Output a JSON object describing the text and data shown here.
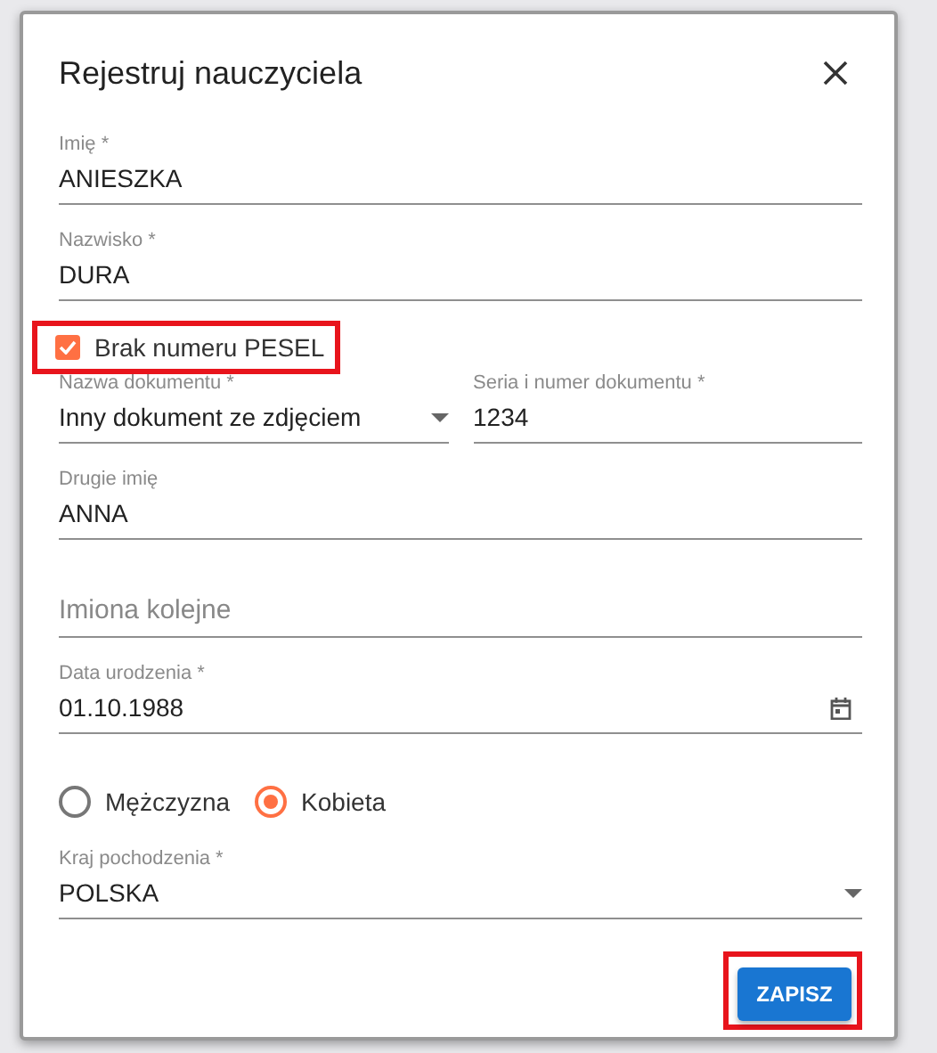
{
  "dialog": {
    "title": "Rejestruj nauczyciela"
  },
  "form": [
    {
      "kind": "text",
      "label": "Imię *",
      "value": "ANIESZKA"
    },
    {
      "kind": "text",
      "label": "Nazwisko *",
      "value": "DURA"
    },
    {
      "kind": "checkbox",
      "label": "Brak numeru PESEL",
      "checked": true,
      "highlighted": true
    },
    {
      "kind": "row",
      "items": [
        {
          "kind": "select",
          "label": "Nazwa dokumentu *",
          "value": "Inny dokument ze zdjęciem"
        },
        {
          "kind": "text",
          "label": "Seria i numer dokumentu *",
          "value": "1234"
        }
      ]
    },
    {
      "kind": "text",
      "label": "Drugie imię",
      "value": "ANNA"
    },
    {
      "kind": "text",
      "placeholder": "Imiona kolejne"
    },
    {
      "kind": "date",
      "label": "Data urodzenia *",
      "value": "01.10.1988"
    },
    {
      "kind": "radio_group",
      "options": [
        {
          "label": "Mężczyzna",
          "selected": false
        },
        {
          "label": "Kobieta",
          "selected": true
        }
      ]
    },
    {
      "kind": "select",
      "label": "Kraj pochodzenia *",
      "value": "POLSKA"
    }
  ],
  "submit": {
    "label": "ZAPISZ",
    "highlighted": true
  }
}
